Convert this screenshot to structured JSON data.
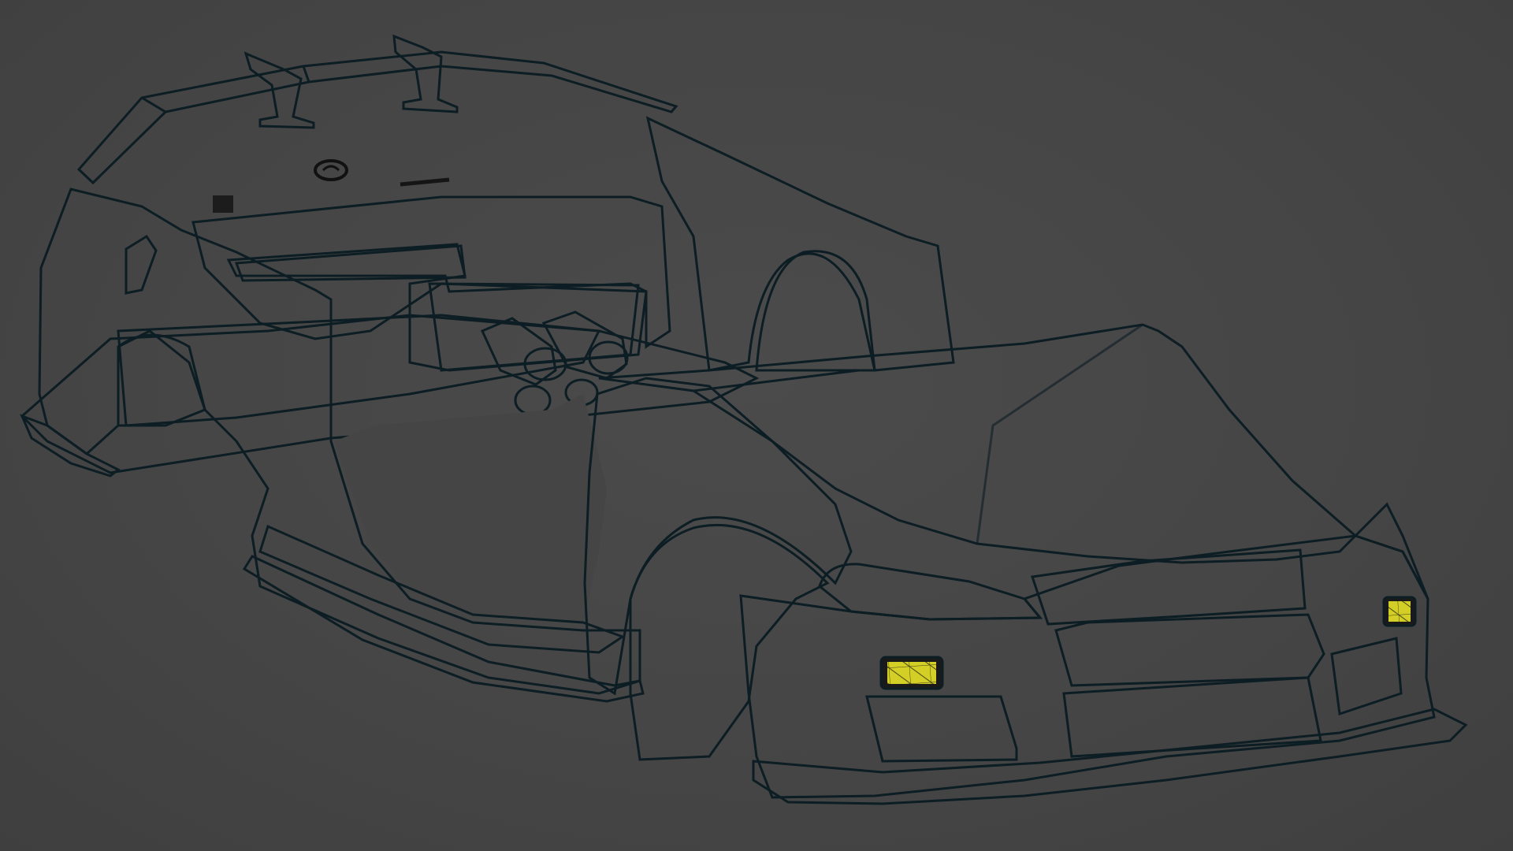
{
  "viewport": {
    "background": "#454545",
    "description_colors": {
      "body_panel": "#1f9fc6",
      "body_panel_light": "#29acd3",
      "mesh_line": "#0f2a33",
      "grille_mesh": "#d4cf27",
      "underside": "#39b82b",
      "wing_support": "#3fbf2e"
    }
  },
  "model": {
    "parts": [
      {
        "name": "rear-wing",
        "color": "#1f9fc6"
      },
      {
        "name": "wing-support-left",
        "color": "#3fbf2e"
      },
      {
        "name": "wing-support-right",
        "color": "#3fbf2e"
      },
      {
        "name": "rear-quarter-left",
        "color": "#1f9fc6"
      },
      {
        "name": "rear-bumper-inner",
        "color": "#d4cf27"
      },
      {
        "name": "exhaust-tips",
        "color": "#3fbf2e"
      },
      {
        "name": "floor-underside",
        "color": "#39b82b"
      },
      {
        "name": "side-skirt",
        "color": "#1f9fc6"
      },
      {
        "name": "rear-quarter-right",
        "color": "#1f9fc6"
      },
      {
        "name": "hood",
        "color": "#1f9fc6"
      },
      {
        "name": "front-fender-left",
        "color": "#1f9fc6"
      },
      {
        "name": "front-bumper",
        "color": "#1f9fc6"
      },
      {
        "name": "front-grille",
        "color": "#d4cf27"
      },
      {
        "name": "front-lip",
        "color": "#39b82b"
      }
    ]
  }
}
